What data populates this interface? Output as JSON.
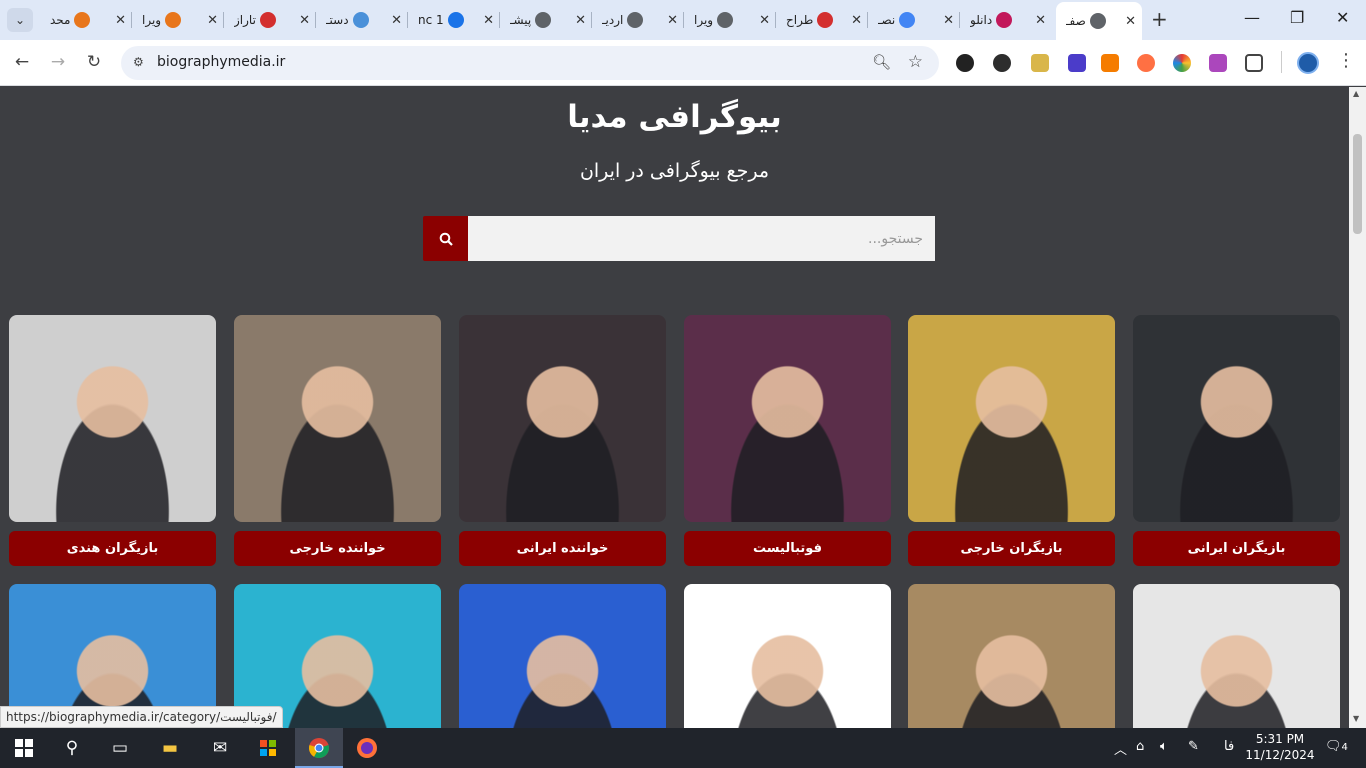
{
  "browser": {
    "tabs": [
      {
        "label": "محد",
        "color": "#e8761c",
        "icon": "n-logo-icon"
      },
      {
        "label": "ویرا",
        "color": "#e8761c",
        "icon": "n-logo-icon"
      },
      {
        "label": "تاراز",
        "color": "#d32f2f",
        "icon": "record-icon"
      },
      {
        "label": "دستـ",
        "color": "#4a90d9",
        "icon": "globe-icon"
      },
      {
        "label": "1 nc",
        "color": "#1a73e8",
        "icon": "loading-icon"
      },
      {
        "label": "پیشـ",
        "color": "#5f6368",
        "icon": "globe-icon"
      },
      {
        "label": "اردیـ",
        "color": "#5f6368",
        "icon": "globe-icon"
      },
      {
        "label": "ویرا",
        "color": "#5f6368",
        "icon": "globe-icon"
      },
      {
        "label": "طراح",
        "color": "#d32f2f",
        "icon": "flag-icon"
      },
      {
        "label": "نصـ",
        "color": "#4285f4",
        "icon": "google-icon"
      },
      {
        "label": "دانلو",
        "color": "#c2185b",
        "icon": "app-icon"
      },
      {
        "label": "صفـ",
        "color": "#5f6368",
        "icon": "globe-icon",
        "active": true
      }
    ],
    "url": "biographymedia.ir",
    "status_url": "https://biographymedia.ir/category/فوتبالیست/"
  },
  "site": {
    "title": "بیوگرافی مدیا",
    "subtitle": "مرجع بیوگرافی در ایران",
    "search_placeholder": "جستجو..."
  },
  "categories_row1": [
    {
      "label": "بازیگران هندی",
      "bg": "#cfcfcf"
    },
    {
      "label": "خواننده خارجی",
      "bg": "#8a7a6a"
    },
    {
      "label": "خواننده ایرانی",
      "bg": "#3a3237"
    },
    {
      "label": "فوتبالیست",
      "bg": "#5b2e4a"
    },
    {
      "label": "بازیگران خارجی",
      "bg": "#c9a646"
    },
    {
      "label": "بازیگران ایرانی",
      "bg": "#2f3236"
    }
  ],
  "categories_row2": [
    {
      "bg": "#3a8fd6"
    },
    {
      "bg": "#2bb3d0"
    },
    {
      "bg": "#2a5fd1"
    },
    {
      "bg": "#ffffff"
    },
    {
      "bg": "#a78a62"
    },
    {
      "bg": "#e6e6e6"
    }
  ],
  "taskbar": {
    "time": "5:31 PM",
    "date": "11/12/2024",
    "lang": "فا",
    "notifications": "4"
  }
}
